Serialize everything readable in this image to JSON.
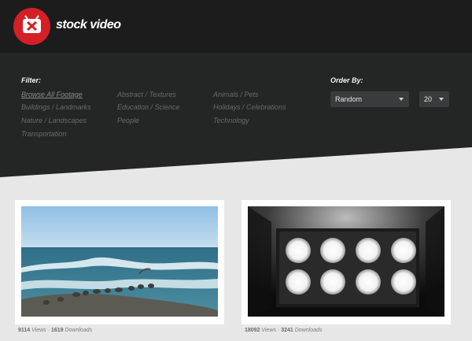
{
  "brand": {
    "name": "stock video",
    "accent": "#d51f26"
  },
  "filter": {
    "title": "Filter:",
    "columns": [
      [
        "Browse All Footage",
        "Buildings / Landmarks",
        "Nature / Landscapes",
        "Transportation"
      ],
      [
        "Abstract / Textures",
        "Education / Science",
        "People"
      ],
      [
        "Animals / Pets",
        "Holidays / Celebrations",
        "Technology"
      ]
    ],
    "active": "Browse All Footage"
  },
  "order": {
    "title": "Order By:",
    "sort_value": "Random",
    "count_value": "20"
  },
  "videos": [
    {
      "views": "9114",
      "views_label": "Views",
      "separator": "·",
      "downloads": "1619",
      "downloads_label": "Downloads"
    },
    {
      "views": "18092",
      "views_label": "Views",
      "separator": "·",
      "downloads": "3241",
      "downloads_label": "Downloads"
    }
  ]
}
